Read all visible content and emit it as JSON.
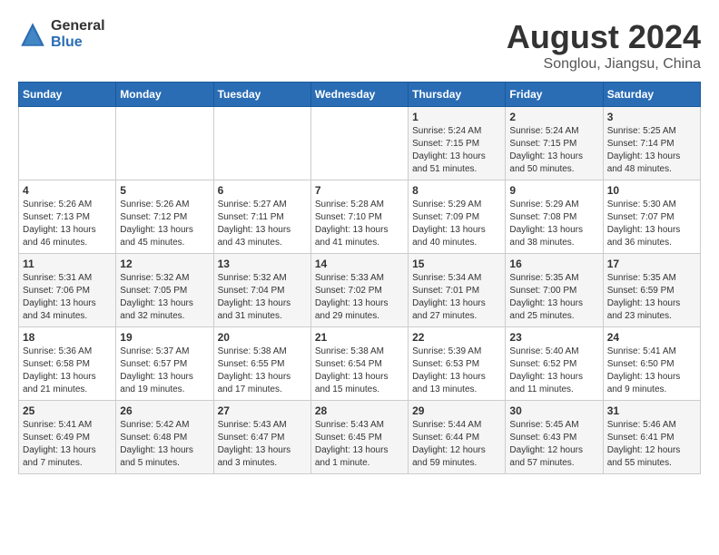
{
  "logo": {
    "general": "General",
    "blue": "Blue"
  },
  "title": {
    "month_year": "August 2024",
    "location": "Songlou, Jiangsu, China"
  },
  "headers": [
    "Sunday",
    "Monday",
    "Tuesday",
    "Wednesday",
    "Thursday",
    "Friday",
    "Saturday"
  ],
  "weeks": [
    [
      {
        "day": "",
        "info": ""
      },
      {
        "day": "",
        "info": ""
      },
      {
        "day": "",
        "info": ""
      },
      {
        "day": "",
        "info": ""
      },
      {
        "day": "1",
        "info": "Sunrise: 5:24 AM\nSunset: 7:15 PM\nDaylight: 13 hours\nand 51 minutes."
      },
      {
        "day": "2",
        "info": "Sunrise: 5:24 AM\nSunset: 7:15 PM\nDaylight: 13 hours\nand 50 minutes."
      },
      {
        "day": "3",
        "info": "Sunrise: 5:25 AM\nSunset: 7:14 PM\nDaylight: 13 hours\nand 48 minutes."
      }
    ],
    [
      {
        "day": "4",
        "info": "Sunrise: 5:26 AM\nSunset: 7:13 PM\nDaylight: 13 hours\nand 46 minutes."
      },
      {
        "day": "5",
        "info": "Sunrise: 5:26 AM\nSunset: 7:12 PM\nDaylight: 13 hours\nand 45 minutes."
      },
      {
        "day": "6",
        "info": "Sunrise: 5:27 AM\nSunset: 7:11 PM\nDaylight: 13 hours\nand 43 minutes."
      },
      {
        "day": "7",
        "info": "Sunrise: 5:28 AM\nSunset: 7:10 PM\nDaylight: 13 hours\nand 41 minutes."
      },
      {
        "day": "8",
        "info": "Sunrise: 5:29 AM\nSunset: 7:09 PM\nDaylight: 13 hours\nand 40 minutes."
      },
      {
        "day": "9",
        "info": "Sunrise: 5:29 AM\nSunset: 7:08 PM\nDaylight: 13 hours\nand 38 minutes."
      },
      {
        "day": "10",
        "info": "Sunrise: 5:30 AM\nSunset: 7:07 PM\nDaylight: 13 hours\nand 36 minutes."
      }
    ],
    [
      {
        "day": "11",
        "info": "Sunrise: 5:31 AM\nSunset: 7:06 PM\nDaylight: 13 hours\nand 34 minutes."
      },
      {
        "day": "12",
        "info": "Sunrise: 5:32 AM\nSunset: 7:05 PM\nDaylight: 13 hours\nand 32 minutes."
      },
      {
        "day": "13",
        "info": "Sunrise: 5:32 AM\nSunset: 7:04 PM\nDaylight: 13 hours\nand 31 minutes."
      },
      {
        "day": "14",
        "info": "Sunrise: 5:33 AM\nSunset: 7:02 PM\nDaylight: 13 hours\nand 29 minutes."
      },
      {
        "day": "15",
        "info": "Sunrise: 5:34 AM\nSunset: 7:01 PM\nDaylight: 13 hours\nand 27 minutes."
      },
      {
        "day": "16",
        "info": "Sunrise: 5:35 AM\nSunset: 7:00 PM\nDaylight: 13 hours\nand 25 minutes."
      },
      {
        "day": "17",
        "info": "Sunrise: 5:35 AM\nSunset: 6:59 PM\nDaylight: 13 hours\nand 23 minutes."
      }
    ],
    [
      {
        "day": "18",
        "info": "Sunrise: 5:36 AM\nSunset: 6:58 PM\nDaylight: 13 hours\nand 21 minutes."
      },
      {
        "day": "19",
        "info": "Sunrise: 5:37 AM\nSunset: 6:57 PM\nDaylight: 13 hours\nand 19 minutes."
      },
      {
        "day": "20",
        "info": "Sunrise: 5:38 AM\nSunset: 6:55 PM\nDaylight: 13 hours\nand 17 minutes."
      },
      {
        "day": "21",
        "info": "Sunrise: 5:38 AM\nSunset: 6:54 PM\nDaylight: 13 hours\nand 15 minutes."
      },
      {
        "day": "22",
        "info": "Sunrise: 5:39 AM\nSunset: 6:53 PM\nDaylight: 13 hours\nand 13 minutes."
      },
      {
        "day": "23",
        "info": "Sunrise: 5:40 AM\nSunset: 6:52 PM\nDaylight: 13 hours\nand 11 minutes."
      },
      {
        "day": "24",
        "info": "Sunrise: 5:41 AM\nSunset: 6:50 PM\nDaylight: 13 hours\nand 9 minutes."
      }
    ],
    [
      {
        "day": "25",
        "info": "Sunrise: 5:41 AM\nSunset: 6:49 PM\nDaylight: 13 hours\nand 7 minutes."
      },
      {
        "day": "26",
        "info": "Sunrise: 5:42 AM\nSunset: 6:48 PM\nDaylight: 13 hours\nand 5 minutes."
      },
      {
        "day": "27",
        "info": "Sunrise: 5:43 AM\nSunset: 6:47 PM\nDaylight: 13 hours\nand 3 minutes."
      },
      {
        "day": "28",
        "info": "Sunrise: 5:43 AM\nSunset: 6:45 PM\nDaylight: 13 hours\nand 1 minute."
      },
      {
        "day": "29",
        "info": "Sunrise: 5:44 AM\nSunset: 6:44 PM\nDaylight: 12 hours\nand 59 minutes."
      },
      {
        "day": "30",
        "info": "Sunrise: 5:45 AM\nSunset: 6:43 PM\nDaylight: 12 hours\nand 57 minutes."
      },
      {
        "day": "31",
        "info": "Sunrise: 5:46 AM\nSunset: 6:41 PM\nDaylight: 12 hours\nand 55 minutes."
      }
    ]
  ]
}
